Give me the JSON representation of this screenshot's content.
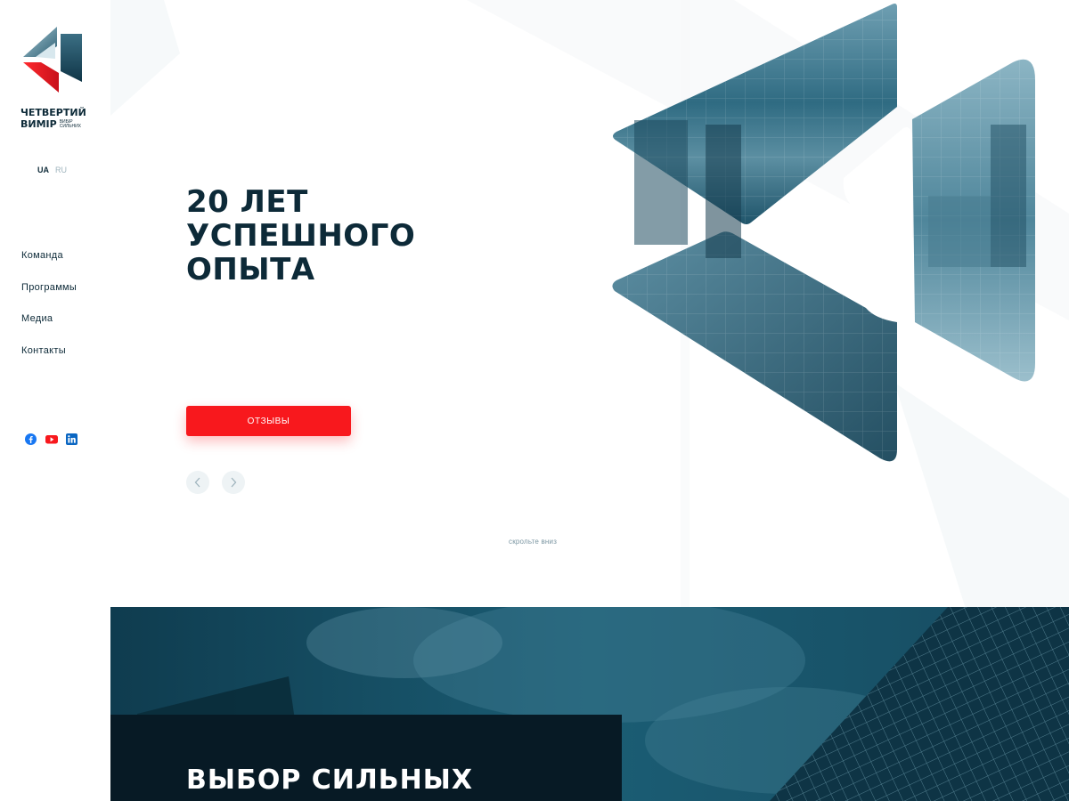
{
  "brand": {
    "name_line1": "ЧЕТВЕРТИЙ",
    "name_line2": "ВИМІР",
    "tagline": "ВИБІР СИЛЬНИХ"
  },
  "languages": {
    "active": "UA",
    "inactive": "RU"
  },
  "nav": {
    "items": [
      {
        "label": "Команда"
      },
      {
        "label": "Программы"
      },
      {
        "label": "Медиа"
      },
      {
        "label": "Контакты"
      }
    ]
  },
  "social": {
    "icons": [
      "facebook-icon",
      "youtube-icon",
      "linkedin-icon"
    ]
  },
  "hero": {
    "title_lines": [
      "20 ЛЕТ",
      "УСПЕШНОГО",
      "ОПЫТА"
    ],
    "cta_label": "ОТЗЫВЫ",
    "scroll_hint": "скрольте вниз"
  },
  "section2": {
    "title": "ВЫБОР СИЛЬНЫХ"
  },
  "colors": {
    "accent": "#f8181d",
    "dark": "#0d2a38",
    "teal": "#2f6b82",
    "muted": "#9fb4bd"
  }
}
